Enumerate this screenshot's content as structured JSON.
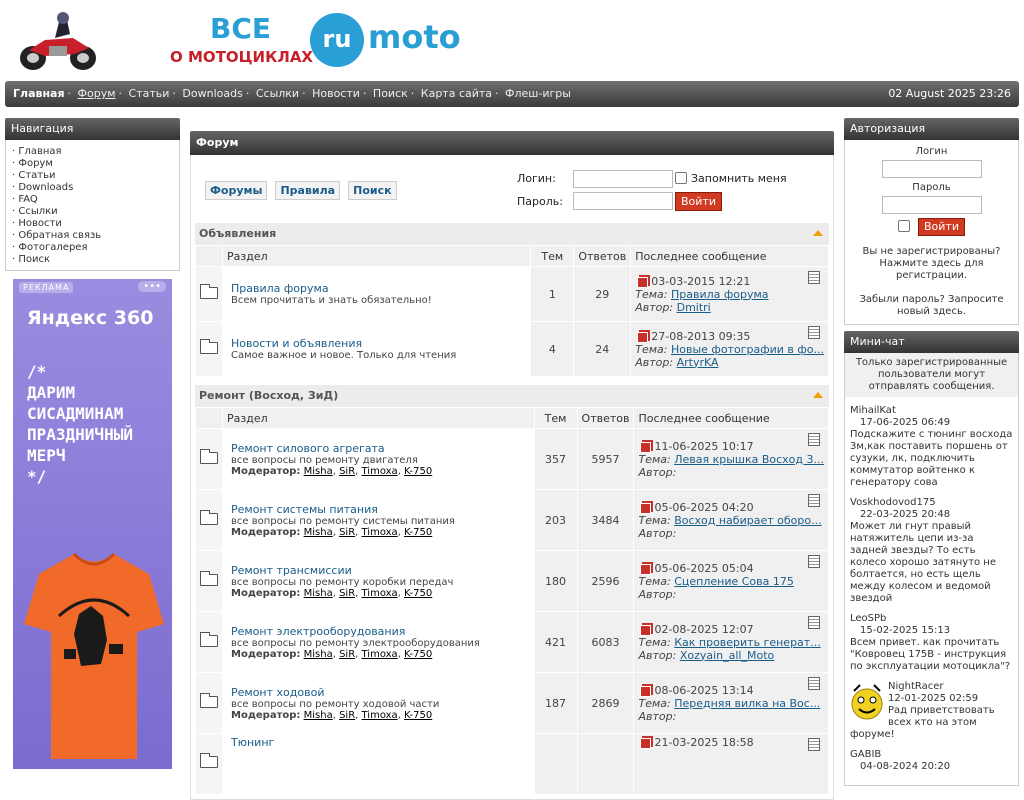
{
  "header": {
    "logo_text_line1": "ВСЕ",
    "logo_text_line2": "О МОТОЦИКЛАХ",
    "logo_brand_ru": "ru",
    "logo_brand_moto": "moto"
  },
  "topnav": {
    "items": [
      "Главная",
      "Форум",
      "Статьи",
      "Downloads",
      "Ссылки",
      "Новости",
      "Поиск",
      "Карта сайта",
      "Флеш-игры"
    ],
    "datetime": "02 August 2025 23:26"
  },
  "left": {
    "nav_title": "Навигация",
    "nav_items": [
      "Главная",
      "Форум",
      "Статьи",
      "Downloads",
      "FAQ",
      "Ссылки",
      "Новости",
      "Обратная связь",
      "Фотогалерея",
      "Поиск"
    ],
    "ad": {
      "tag": "РЕКЛАМА",
      "dots": "•••",
      "brand": "Яндекс 360",
      "promo": "/*\nДАРИМ\nСИСАДМИНАМ\nПРАЗДНИЧНЫЙ\nМЕРЧ\n*/"
    }
  },
  "main": {
    "title": "Форум",
    "buttons": [
      "Форумы",
      "Правила",
      "Поиск"
    ],
    "login_label": "Логин:",
    "password_label": "Пароль:",
    "remember_label": "Запомнить меня",
    "login_button": "Войти",
    "columns": {
      "section": "Раздел",
      "topics": "Тем",
      "replies": "Ответов",
      "last": "Последнее сообщение"
    },
    "labels": {
      "theme": "Тема:",
      "author": "Автор:",
      "moderator": "Модератор:"
    },
    "moderators": [
      "Misha",
      "SiR",
      "Timoxa",
      "K-750"
    ],
    "categories": [
      {
        "name": "Объявления",
        "forums": [
          {
            "title": "Правила форума",
            "desc": "Всем прочитать и знать обязательно!",
            "topics": "1",
            "replies": "29",
            "last_date": "03-03-2015 12:21",
            "last_topic": "Правила форума",
            "last_author": "Dmitri",
            "mods": false
          },
          {
            "title": "Новости и объявления",
            "desc": "Самое важное и новое. Только для чтения",
            "topics": "4",
            "replies": "24",
            "last_date": "27-08-2013 09:35",
            "last_topic": "Новые фотографии в фо...",
            "last_author": "ArtyrKA",
            "mods": false
          }
        ]
      },
      {
        "name": "Ремонт (Восход, ЗиД)",
        "forums": [
          {
            "title": "Ремонт силового агрегата",
            "desc": "все вопросы по ремонту двигателя",
            "topics": "357",
            "replies": "5957",
            "last_date": "11-06-2025 10:17",
            "last_topic": "Левая крышка Восход 3...",
            "last_author": "",
            "mods": true
          },
          {
            "title": "Ремонт системы питания",
            "desc": "все вопросы по ремонту системы питания",
            "topics": "203",
            "replies": "3484",
            "last_date": "05-06-2025 04:20",
            "last_topic": "Восход набирает оборо...",
            "last_author": "",
            "mods": true
          },
          {
            "title": "Ремонт трансмиссии",
            "desc": "все вопросы по ремонту коробки передач",
            "topics": "180",
            "replies": "2596",
            "last_date": "05-06-2025 05:04",
            "last_topic": "Сцепление Сова 175",
            "last_author": "",
            "mods": true
          },
          {
            "title": "Ремонт электрооборудования",
            "desc": "все вопросы по ремонту электрооборудования",
            "topics": "421",
            "replies": "6083",
            "last_date": "02-08-2025 12:07",
            "last_topic": "Как проверить генерат...",
            "last_author": "Xozyain_all_Moto",
            "mods": true
          },
          {
            "title": "Ремонт ходовой",
            "desc": "все вопросы по ремонту ходовой части",
            "topics": "187",
            "replies": "2869",
            "last_date": "08-06-2025 13:14",
            "last_topic": "Передняя вилка на Вос...",
            "last_author": "",
            "mods": true
          },
          {
            "title": "Тюнинг",
            "desc": "",
            "topics": "",
            "replies": "",
            "last_date": "21-03-2025 18:58",
            "last_topic": "",
            "last_author": "",
            "mods": false
          }
        ]
      }
    ]
  },
  "right": {
    "auth_title": "Авторизация",
    "login_label": "Логин",
    "password_label": "Пароль",
    "login_button": "Войти",
    "register_text": "Вы не зарегистрированы? Нажмите здесь для регистрации.",
    "forgot_text": "Забыли пароль? Запросите новый здесь.",
    "chat_title": "Мини-чат",
    "chat_notice": "Только зарегистрированные пользователи могут отправлять сообщения.",
    "messages": [
      {
        "name": "MihailKat",
        "date": "17-06-2025 06:49",
        "text": "Подскажите с тюнинг восхода 3м,как поставить поршень от сузуки, лк, подключить коммутатор войтенко к генератору сова"
      },
      {
        "name": "Voskhodovod175",
        "date": "22-03-2025 20:48",
        "text": "Может ли гнут правый натяжитель цепи из-за задней звезды? То есть колесо хорошо затянуто не болтается, но есть щель между колесом и ведомой звездой"
      },
      {
        "name": "LeoSPb",
        "date": "15-02-2025 15:13",
        "text": "Всем привет. как прочитать \"Ковровец 175В - инструкция по эксплуатации мотоцикла\"?"
      },
      {
        "name": "NightRacer",
        "date": "12-01-2025 02:59",
        "text": "Рад приветствовать всех кто на этом форуме!"
      },
      {
        "name": "GABIB",
        "date": "04-08-2024 20:20",
        "text": ""
      }
    ]
  },
  "colors": {
    "accent_red": "#d03a20",
    "link": "#1a5c8a",
    "bar_dark": "#3b3b3b"
  }
}
